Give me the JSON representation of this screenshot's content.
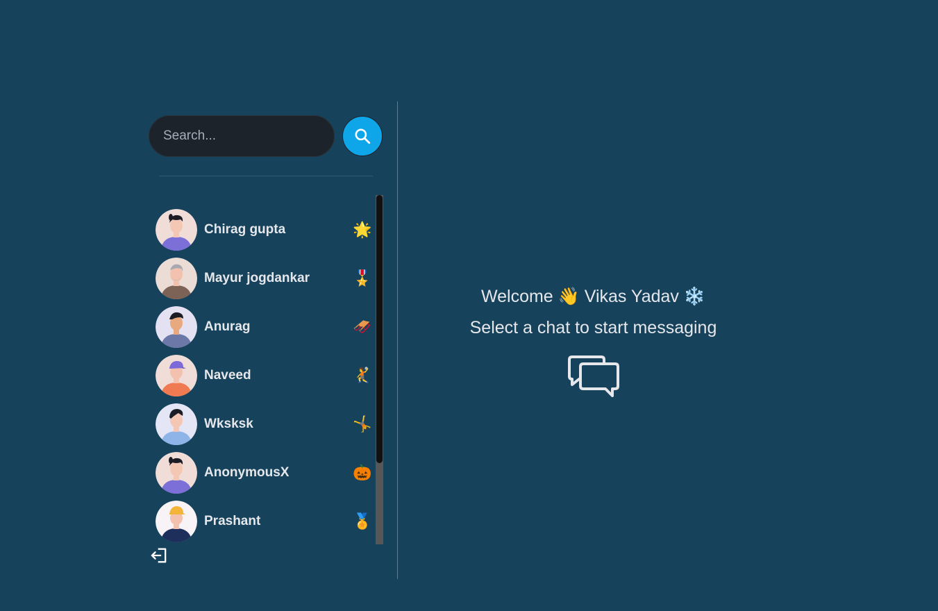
{
  "search": {
    "placeholder": "Search..."
  },
  "conversations": [
    {
      "name": "Chirag gupta",
      "emoji": "🌟"
    },
    {
      "name": "Mayur jogdankar",
      "emoji": "🎖️"
    },
    {
      "name": "Anurag",
      "emoji": "🛷"
    },
    {
      "name": "Naveed",
      "emoji": "🤾"
    },
    {
      "name": "Wksksk",
      "emoji": "🤸"
    },
    {
      "name": "AnonymousX",
      "emoji": "🎃"
    },
    {
      "name": "Prashant",
      "emoji": "🏅"
    }
  ],
  "welcome": {
    "greeting": "Welcome 👋 Vikas Yadav ❄️",
    "subtitle": "Select a chat to start messaging"
  },
  "icons": {
    "search": "search-icon",
    "logout": "logout-icon",
    "chat": "chat-bubbles-icon"
  },
  "colors": {
    "background": "#16425b",
    "accent": "#0ea5e9",
    "input_bg": "#1d232a"
  }
}
